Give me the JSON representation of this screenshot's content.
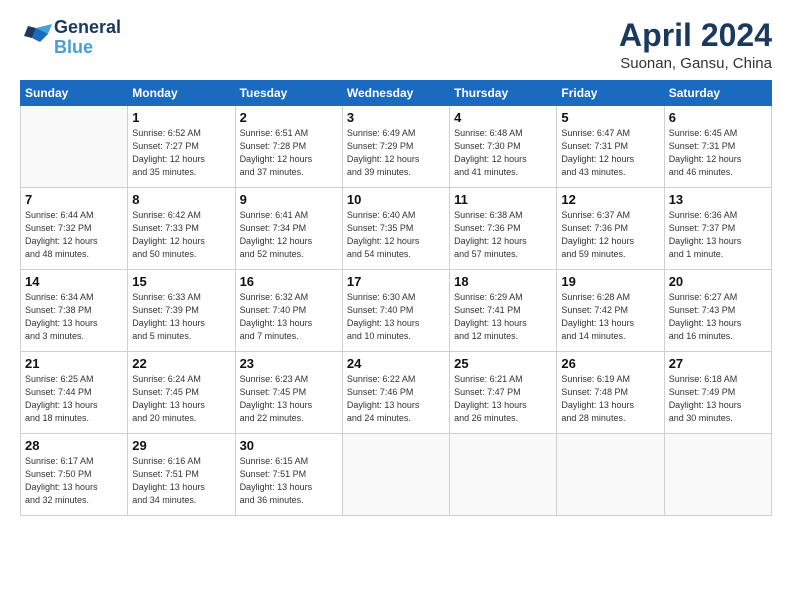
{
  "header": {
    "logo_line1": "General",
    "logo_line2": "Blue",
    "title": "April 2024",
    "subtitle": "Suonan, Gansu, China"
  },
  "days_of_week": [
    "Sunday",
    "Monday",
    "Tuesday",
    "Wednesday",
    "Thursday",
    "Friday",
    "Saturday"
  ],
  "weeks": [
    [
      {
        "day": "",
        "info": ""
      },
      {
        "day": "1",
        "info": "Sunrise: 6:52 AM\nSunset: 7:27 PM\nDaylight: 12 hours\nand 35 minutes."
      },
      {
        "day": "2",
        "info": "Sunrise: 6:51 AM\nSunset: 7:28 PM\nDaylight: 12 hours\nand 37 minutes."
      },
      {
        "day": "3",
        "info": "Sunrise: 6:49 AM\nSunset: 7:29 PM\nDaylight: 12 hours\nand 39 minutes."
      },
      {
        "day": "4",
        "info": "Sunrise: 6:48 AM\nSunset: 7:30 PM\nDaylight: 12 hours\nand 41 minutes."
      },
      {
        "day": "5",
        "info": "Sunrise: 6:47 AM\nSunset: 7:31 PM\nDaylight: 12 hours\nand 43 minutes."
      },
      {
        "day": "6",
        "info": "Sunrise: 6:45 AM\nSunset: 7:31 PM\nDaylight: 12 hours\nand 46 minutes."
      }
    ],
    [
      {
        "day": "7",
        "info": "Sunrise: 6:44 AM\nSunset: 7:32 PM\nDaylight: 12 hours\nand 48 minutes."
      },
      {
        "day": "8",
        "info": "Sunrise: 6:42 AM\nSunset: 7:33 PM\nDaylight: 12 hours\nand 50 minutes."
      },
      {
        "day": "9",
        "info": "Sunrise: 6:41 AM\nSunset: 7:34 PM\nDaylight: 12 hours\nand 52 minutes."
      },
      {
        "day": "10",
        "info": "Sunrise: 6:40 AM\nSunset: 7:35 PM\nDaylight: 12 hours\nand 54 minutes."
      },
      {
        "day": "11",
        "info": "Sunrise: 6:38 AM\nSunset: 7:36 PM\nDaylight: 12 hours\nand 57 minutes."
      },
      {
        "day": "12",
        "info": "Sunrise: 6:37 AM\nSunset: 7:36 PM\nDaylight: 12 hours\nand 59 minutes."
      },
      {
        "day": "13",
        "info": "Sunrise: 6:36 AM\nSunset: 7:37 PM\nDaylight: 13 hours\nand 1 minute."
      }
    ],
    [
      {
        "day": "14",
        "info": "Sunrise: 6:34 AM\nSunset: 7:38 PM\nDaylight: 13 hours\nand 3 minutes."
      },
      {
        "day": "15",
        "info": "Sunrise: 6:33 AM\nSunset: 7:39 PM\nDaylight: 13 hours\nand 5 minutes."
      },
      {
        "day": "16",
        "info": "Sunrise: 6:32 AM\nSunset: 7:40 PM\nDaylight: 13 hours\nand 7 minutes."
      },
      {
        "day": "17",
        "info": "Sunrise: 6:30 AM\nSunset: 7:40 PM\nDaylight: 13 hours\nand 10 minutes."
      },
      {
        "day": "18",
        "info": "Sunrise: 6:29 AM\nSunset: 7:41 PM\nDaylight: 13 hours\nand 12 minutes."
      },
      {
        "day": "19",
        "info": "Sunrise: 6:28 AM\nSunset: 7:42 PM\nDaylight: 13 hours\nand 14 minutes."
      },
      {
        "day": "20",
        "info": "Sunrise: 6:27 AM\nSunset: 7:43 PM\nDaylight: 13 hours\nand 16 minutes."
      }
    ],
    [
      {
        "day": "21",
        "info": "Sunrise: 6:25 AM\nSunset: 7:44 PM\nDaylight: 13 hours\nand 18 minutes."
      },
      {
        "day": "22",
        "info": "Sunrise: 6:24 AM\nSunset: 7:45 PM\nDaylight: 13 hours\nand 20 minutes."
      },
      {
        "day": "23",
        "info": "Sunrise: 6:23 AM\nSunset: 7:45 PM\nDaylight: 13 hours\nand 22 minutes."
      },
      {
        "day": "24",
        "info": "Sunrise: 6:22 AM\nSunset: 7:46 PM\nDaylight: 13 hours\nand 24 minutes."
      },
      {
        "day": "25",
        "info": "Sunrise: 6:21 AM\nSunset: 7:47 PM\nDaylight: 13 hours\nand 26 minutes."
      },
      {
        "day": "26",
        "info": "Sunrise: 6:19 AM\nSunset: 7:48 PM\nDaylight: 13 hours\nand 28 minutes."
      },
      {
        "day": "27",
        "info": "Sunrise: 6:18 AM\nSunset: 7:49 PM\nDaylight: 13 hours\nand 30 minutes."
      }
    ],
    [
      {
        "day": "28",
        "info": "Sunrise: 6:17 AM\nSunset: 7:50 PM\nDaylight: 13 hours\nand 32 minutes."
      },
      {
        "day": "29",
        "info": "Sunrise: 6:16 AM\nSunset: 7:51 PM\nDaylight: 13 hours\nand 34 minutes."
      },
      {
        "day": "30",
        "info": "Sunrise: 6:15 AM\nSunset: 7:51 PM\nDaylight: 13 hours\nand 36 minutes."
      },
      {
        "day": "",
        "info": ""
      },
      {
        "day": "",
        "info": ""
      },
      {
        "day": "",
        "info": ""
      },
      {
        "day": "",
        "info": ""
      }
    ]
  ]
}
